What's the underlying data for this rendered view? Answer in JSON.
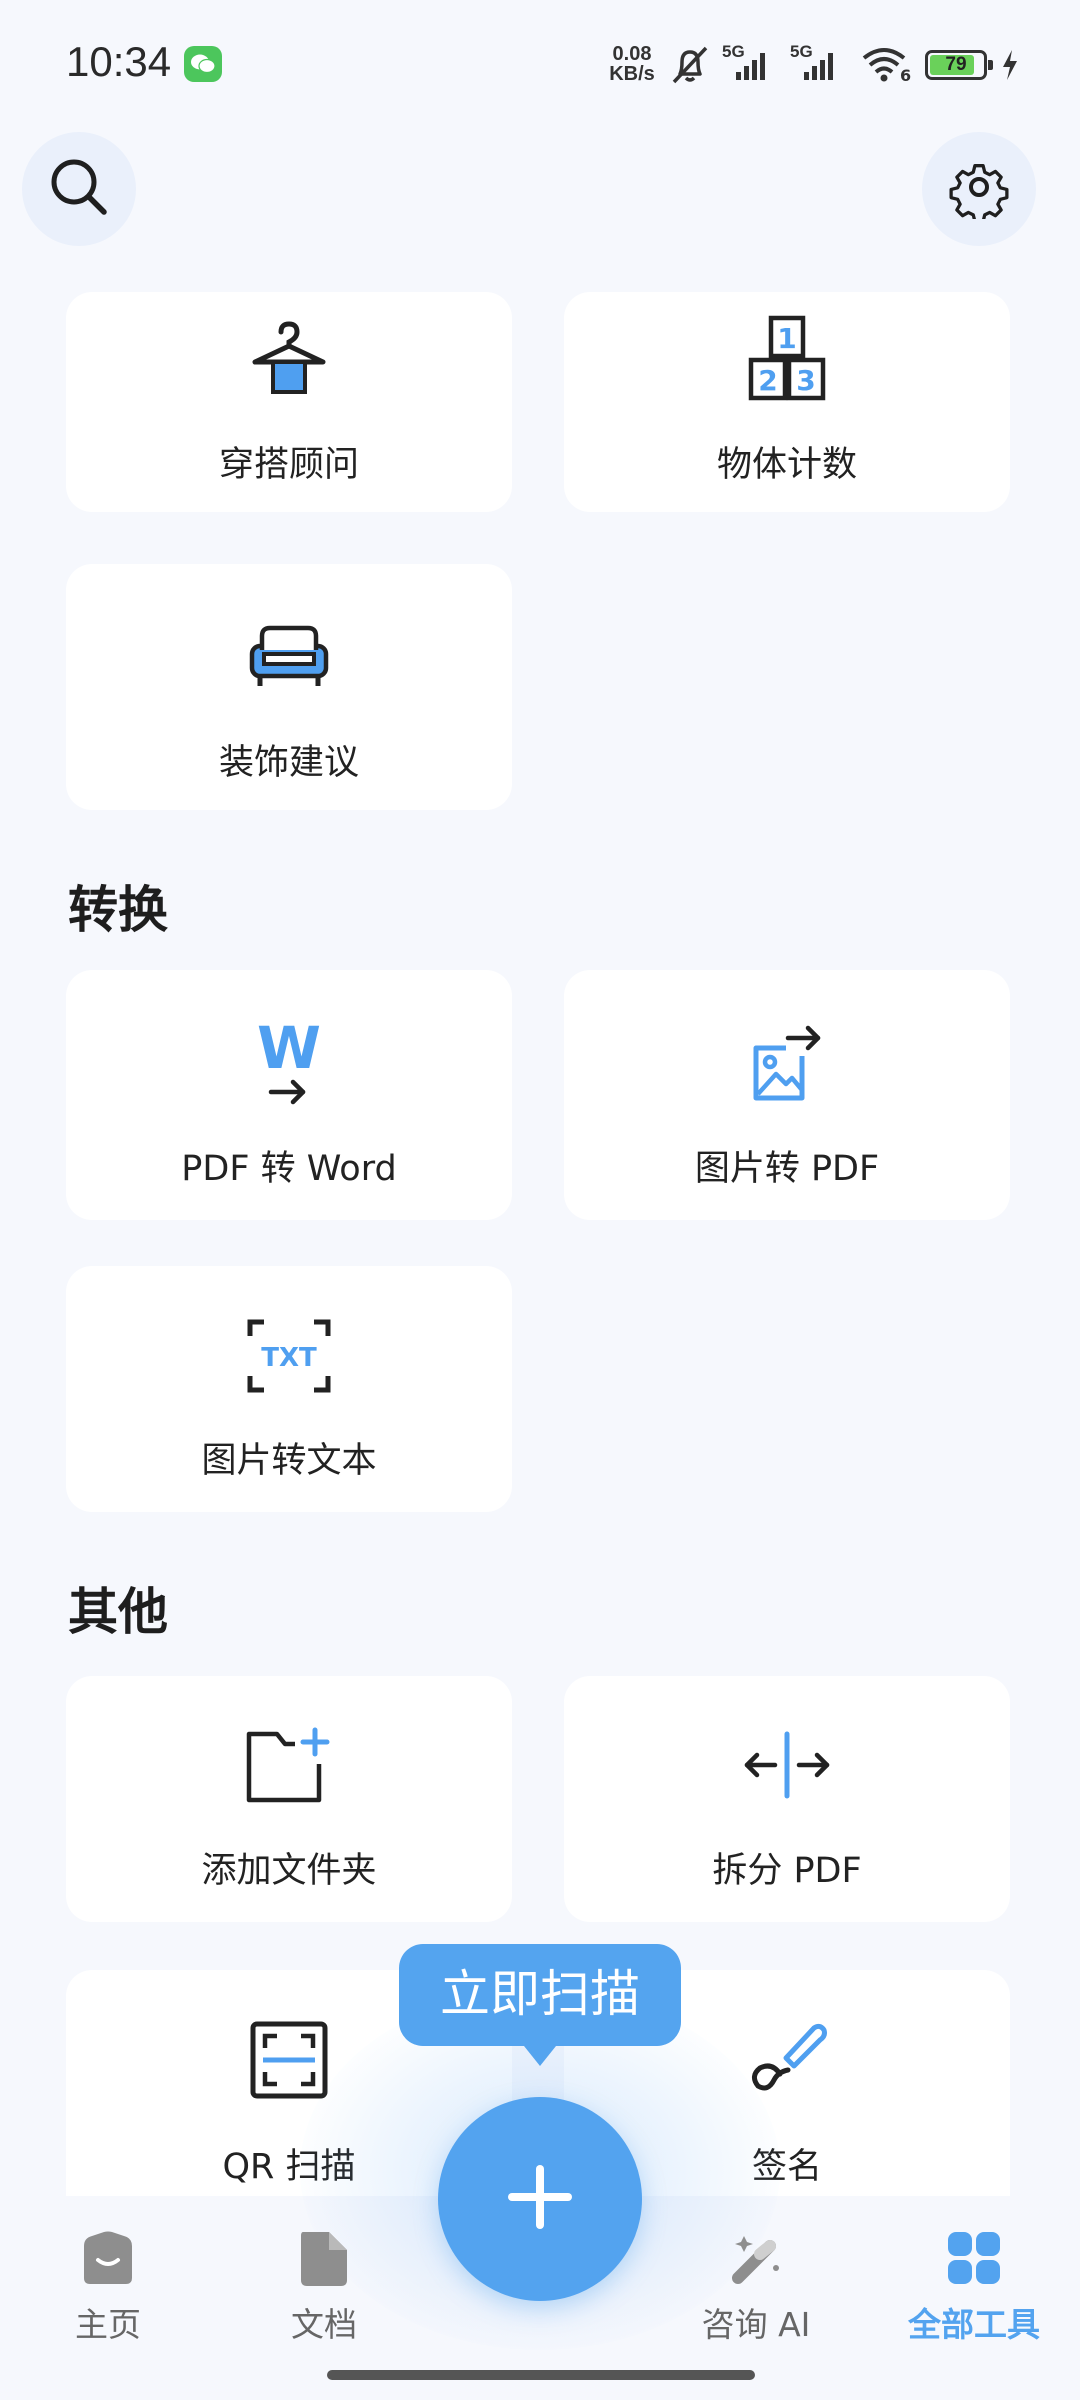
{
  "status_bar": {
    "time": "10:34",
    "net_speed_value": "0.08",
    "net_speed_unit": "KB/s",
    "signal_1": "5G",
    "signal_2": "5G",
    "wifi_label": "6",
    "battery_level": "79"
  },
  "header": {
    "search_icon": "search-icon",
    "settings_icon": "gear-icon"
  },
  "tools_top": [
    {
      "label": "穿搭顾问",
      "icon": "hanger-icon"
    },
    {
      "label": "物体计数",
      "icon": "number-blocks-icon"
    },
    {
      "label": "装饰建议",
      "icon": "sofa-icon"
    }
  ],
  "sections": [
    {
      "title": "转换",
      "items": [
        {
          "label": "PDF 转 Word",
          "icon": "pdf-to-word-icon"
        },
        {
          "label": "图片转 PDF",
          "icon": "image-to-pdf-icon"
        },
        {
          "label": "图片转文本",
          "icon": "image-to-text-icon"
        }
      ]
    },
    {
      "title": "其他",
      "items": [
        {
          "label": "添加文件夹",
          "icon": "add-folder-icon"
        },
        {
          "label": "拆分 PDF",
          "icon": "split-pdf-icon"
        },
        {
          "label": "QR 扫描",
          "icon": "qr-scan-icon"
        },
        {
          "label": "签名",
          "icon": "signature-pen-icon"
        }
      ]
    }
  ],
  "fab": {
    "tooltip": "立即扫描",
    "icon": "plus-icon"
  },
  "bottom_nav": [
    {
      "label": "主页",
      "icon": "home-icon",
      "active": false
    },
    {
      "label": "文档",
      "icon": "document-icon",
      "active": false
    },
    {
      "label": "咨询 AI",
      "icon": "magic-wand-icon",
      "active": false
    },
    {
      "label": "全部工具",
      "icon": "grid-icon",
      "active": true
    }
  ],
  "colors": {
    "accent": "#53a3ef",
    "background": "#f6f8fd",
    "card": "#ffffff",
    "text": "#222222",
    "nav_inactive": "#666666"
  }
}
